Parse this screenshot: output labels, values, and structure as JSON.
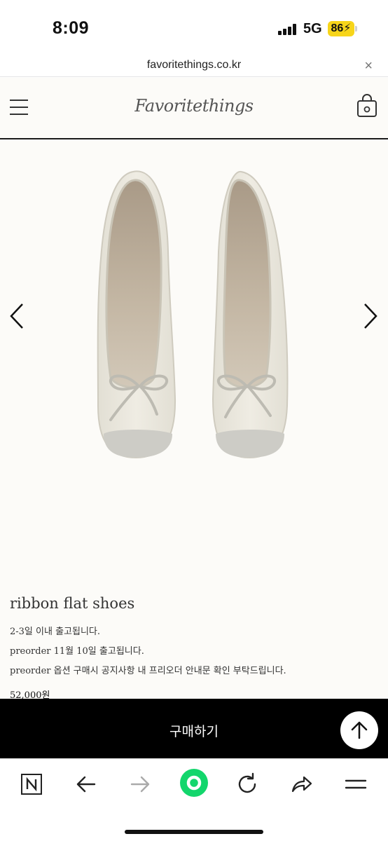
{
  "status_bar": {
    "time": "8:09",
    "network": "5G",
    "battery": "86"
  },
  "url_bar": {
    "url": "favoritethings.co.kr",
    "close_glyph": "×"
  },
  "site": {
    "logo": "Favoritethings"
  },
  "product": {
    "title": "ribbon flat shoes",
    "lines": [
      "2-3일 이내 출고됩니다.",
      "preorder 11월 10일 출고됩니다.",
      "preorder 옵션 구매시 공지사항 내 프리오더 안내문 확인 부탁드립니다."
    ],
    "price": "52,000원",
    "image_name": "ivory ballet flats with ribbon bow"
  },
  "buy_bar": {
    "label": "구매하기"
  },
  "toolbar": {
    "items": [
      "naver-n-icon",
      "back-icon",
      "forward-icon",
      "green-home-icon",
      "reload-icon",
      "share-icon",
      "menu-icon"
    ]
  },
  "colors": {
    "accent_green": "#13d66c",
    "battery_yellow": "#f7d51a",
    "page_bg": "#fcfbf8",
    "buy_bar": "#000000"
  }
}
